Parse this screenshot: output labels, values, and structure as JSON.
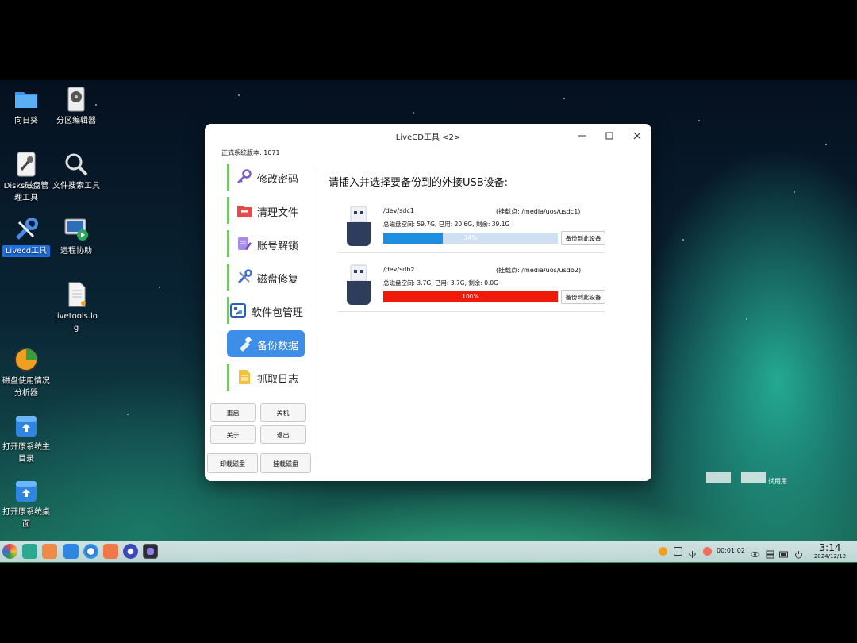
{
  "desktop": {
    "icons": [
      {
        "label": "向日葵"
      },
      {
        "label": "分区编辑器"
      },
      {
        "label": "Disks磁盘管理工具"
      },
      {
        "label": "文件搜索工具"
      },
      {
        "label": "Livecd工具"
      },
      {
        "label": "远程协助"
      },
      {
        "label": "livetools.log"
      },
      {
        "label": "磁盘使用情况分析器"
      },
      {
        "label": "打开原系统主目录"
      },
      {
        "label": "打开原系统桌面"
      }
    ],
    "watermark_text": "试用用"
  },
  "window": {
    "title": "LiveCD工具 <2>",
    "version_label": "正式系统版本: 1071",
    "nav": [
      {
        "label": "修改密码",
        "icon": "key-icon",
        "color": "#7a5cc8"
      },
      {
        "label": "清理文件",
        "icon": "folder-minus-icon",
        "color": "#e84848"
      },
      {
        "label": "账号解锁",
        "icon": "edit-account-icon",
        "color": "#8a6ad8"
      },
      {
        "label": "磁盘修复",
        "icon": "wrench-icon",
        "color": "#3a6bd8"
      },
      {
        "label": "软件包管理",
        "icon": "package-icon",
        "color": "#2a5fb8"
      },
      {
        "label": "备份数据",
        "icon": "usb-icon",
        "color": "#3d8ee8"
      },
      {
        "label": "抓取日志",
        "icon": "document-icon",
        "color": "#f0c040"
      }
    ],
    "buttons": {
      "restart": "重启",
      "shutdown": "关机",
      "about": "关于",
      "exit": "退出",
      "unmount": "卸载磁盘",
      "mount": "挂载磁盘"
    },
    "heading": "请插入并选择要备份到的外接USB设备:",
    "devices": [
      {
        "path": "/dev/sdc1",
        "mount": "(挂载点: /media/uos/usdc1)",
        "space": "总磁盘空间: 59.7G, 已用: 20.6G, 剩余: 39.1G",
        "progress": 0.34,
        "progress_text": "34%",
        "bar_color": "#1e8fe0",
        "button": "备份到此设备"
      },
      {
        "path": "/dev/sdb2",
        "mount": "(挂载点: /media/uos/usdb2)",
        "space": "总磁盘空间: 3.7G, 已用: 3.7G, 剩余: 0.0G",
        "progress": 1.0,
        "progress_text": "100%",
        "bar_color": "#f01a0a",
        "button": "备份到此设备"
      }
    ]
  },
  "taskbar": {
    "timer": "00:01:02",
    "time": "3:14",
    "date": "2024/12/12"
  }
}
